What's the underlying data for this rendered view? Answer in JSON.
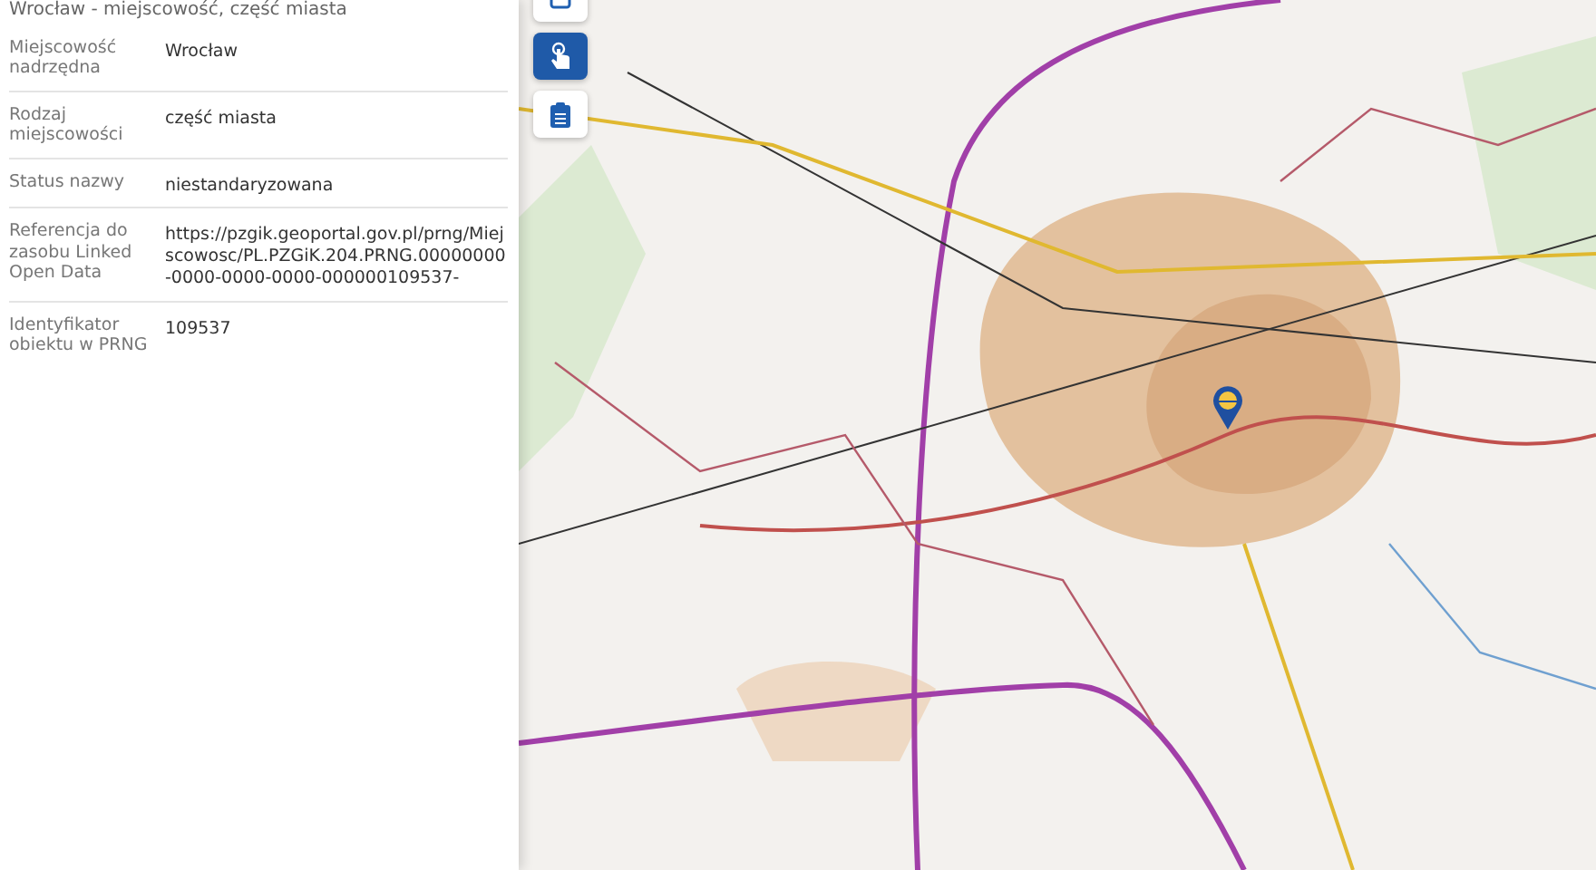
{
  "panel": {
    "title": "Wrocław - miejscowość, część miasta",
    "rows": [
      {
        "label": "Miejscowość nadrzędna",
        "value": "Wrocław"
      },
      {
        "label": "Rodzaj miejscowości",
        "value": "część miasta"
      },
      {
        "label": "Status nazwy",
        "value": "niestandaryzowana"
      },
      {
        "label": "Referencja do zasobu Linked Open Data",
        "value": "https://pzgik.geoportal.gov.pl/prng/Miejscowosc/PL.PZGiK.204.PRNG.00000000-0000-0000-0000-000000109537-"
      },
      {
        "label": "Identyfikator obiektu w PRNG",
        "value": "109537"
      }
    ]
  },
  "toolbar": [
    {
      "kind": "info",
      "selected": false
    },
    {
      "kind": "pointer",
      "selected": true
    },
    {
      "kind": "clipboard",
      "selected": false
    }
  ]
}
